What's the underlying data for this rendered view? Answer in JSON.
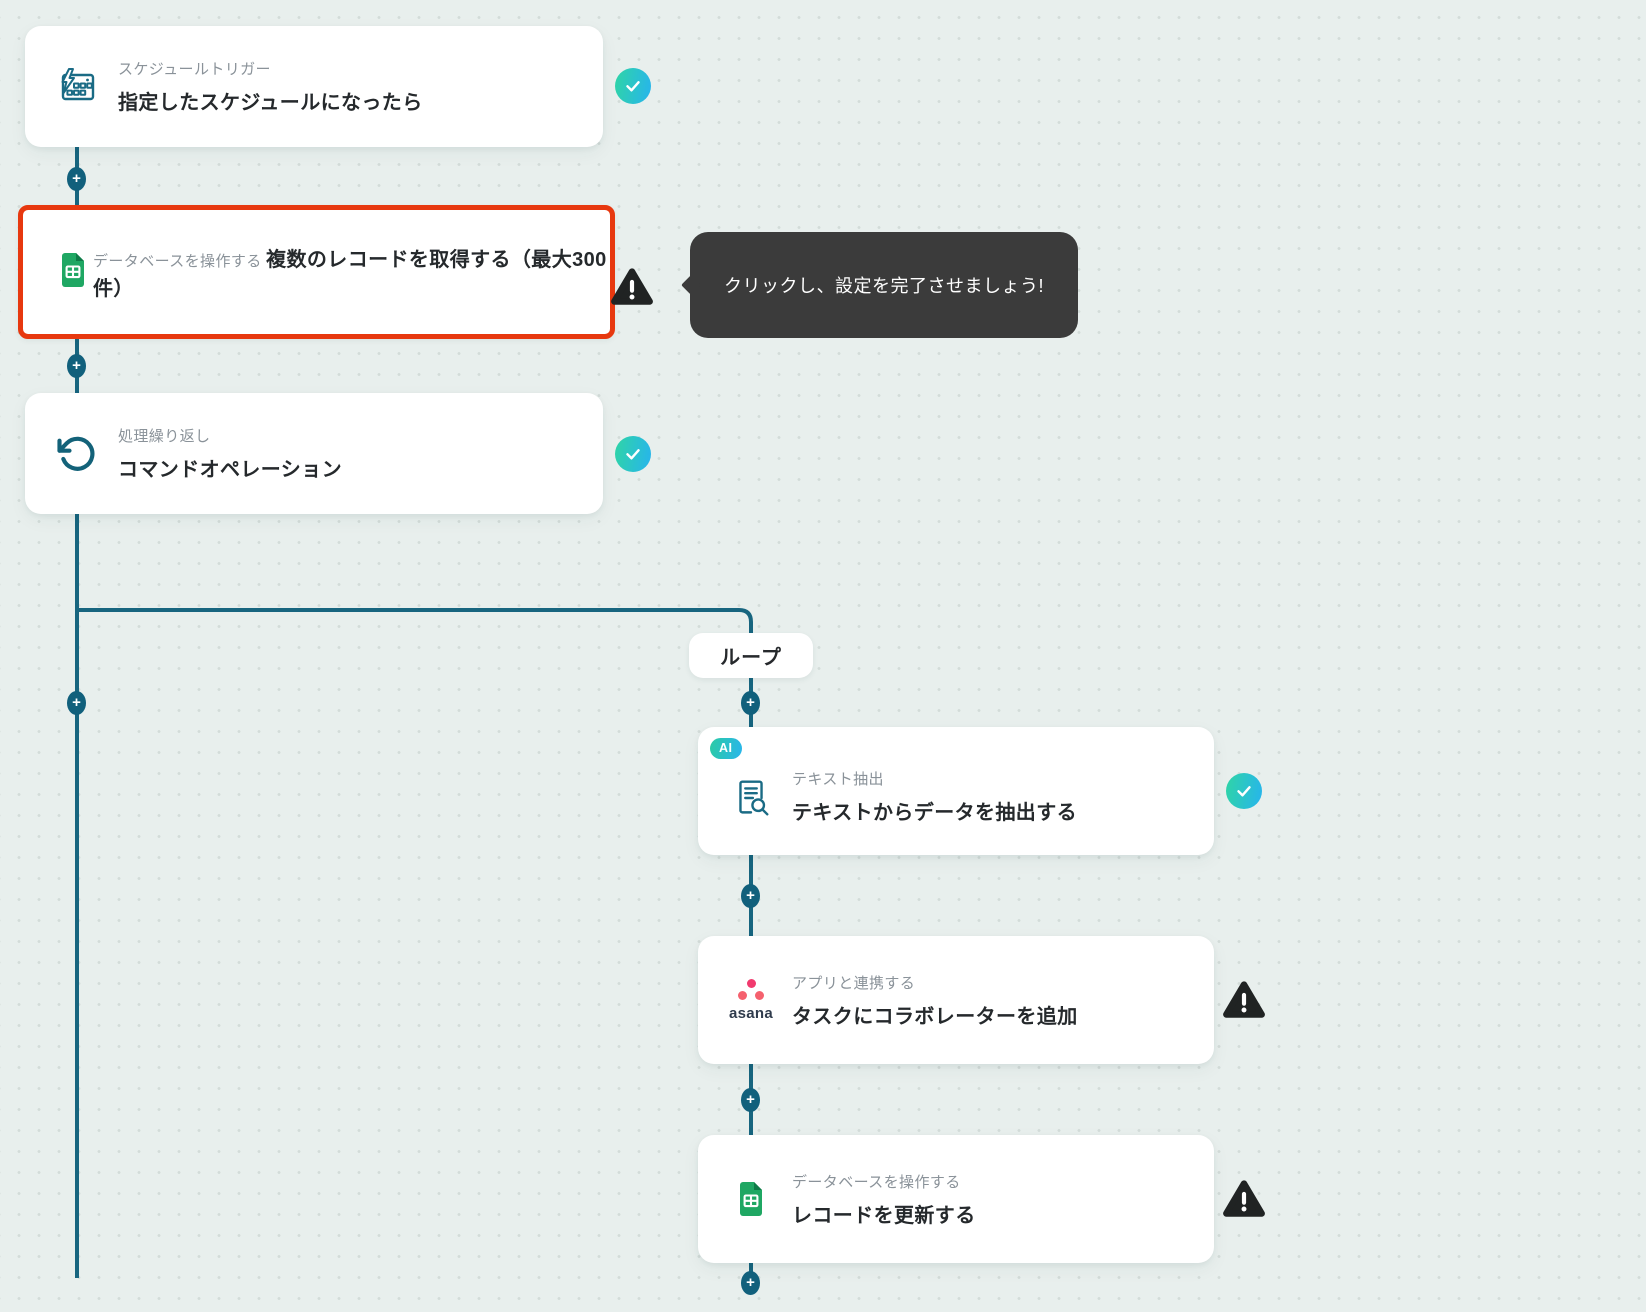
{
  "workflow": {
    "branch_label": "ループ",
    "plus_glyph": "+",
    "tooltip": {
      "text": "クリックし、設定を完了させましょう!"
    },
    "nodes": [
      {
        "id": "schedule-trigger",
        "label": "スケジュールトリガー",
        "title": "指定したスケジュールになったら",
        "icon": "schedule-calendar-lightning-icon",
        "status": "complete",
        "status_icon": "check-icon"
      },
      {
        "id": "get-records",
        "label": "データベースを操作する",
        "title": "複数のレコードを取得する（最大300件）",
        "icon": "google-sheets-icon",
        "status": "warning",
        "status_icon": "warning-icon",
        "highlighted": true
      },
      {
        "id": "command-operation",
        "label": "処理繰り返し",
        "title": "コマンドオペレーション",
        "icon": "repeat-icon",
        "status": "complete",
        "status_icon": "check-icon"
      },
      {
        "id": "extract-text",
        "badge": "AI",
        "label": "テキスト抽出",
        "title": "テキストからデータを抽出する",
        "icon": "document-search-icon",
        "status": "complete",
        "status_icon": "check-icon"
      },
      {
        "id": "asana-add-collaborator",
        "label": "アプリと連携する",
        "title": "タスクにコラボレーターを追加",
        "icon": "asana-icon",
        "icon_text": "asana",
        "status": "warning",
        "status_icon": "warning-icon"
      },
      {
        "id": "update-record",
        "label": "データベースを操作する",
        "title": "レコードを更新する",
        "icon": "google-sheets-icon",
        "status": "warning",
        "status_icon": "warning-icon"
      }
    ]
  },
  "colors": {
    "background": "#E8EFED",
    "connector_teal": "#17657F",
    "plus_fill": "#11607C",
    "highlight_red": "#E7380F",
    "tooltip_bg": "#3B3B3B",
    "check_gradient_start": "#2FD5A5",
    "check_gradient_end": "#27B4EE",
    "warning_black": "#202323",
    "sheets_green": "#1FA763",
    "asana_coral": "#F13A6E",
    "label_grey": "#8A9299",
    "title_dark": "#25292C"
  }
}
